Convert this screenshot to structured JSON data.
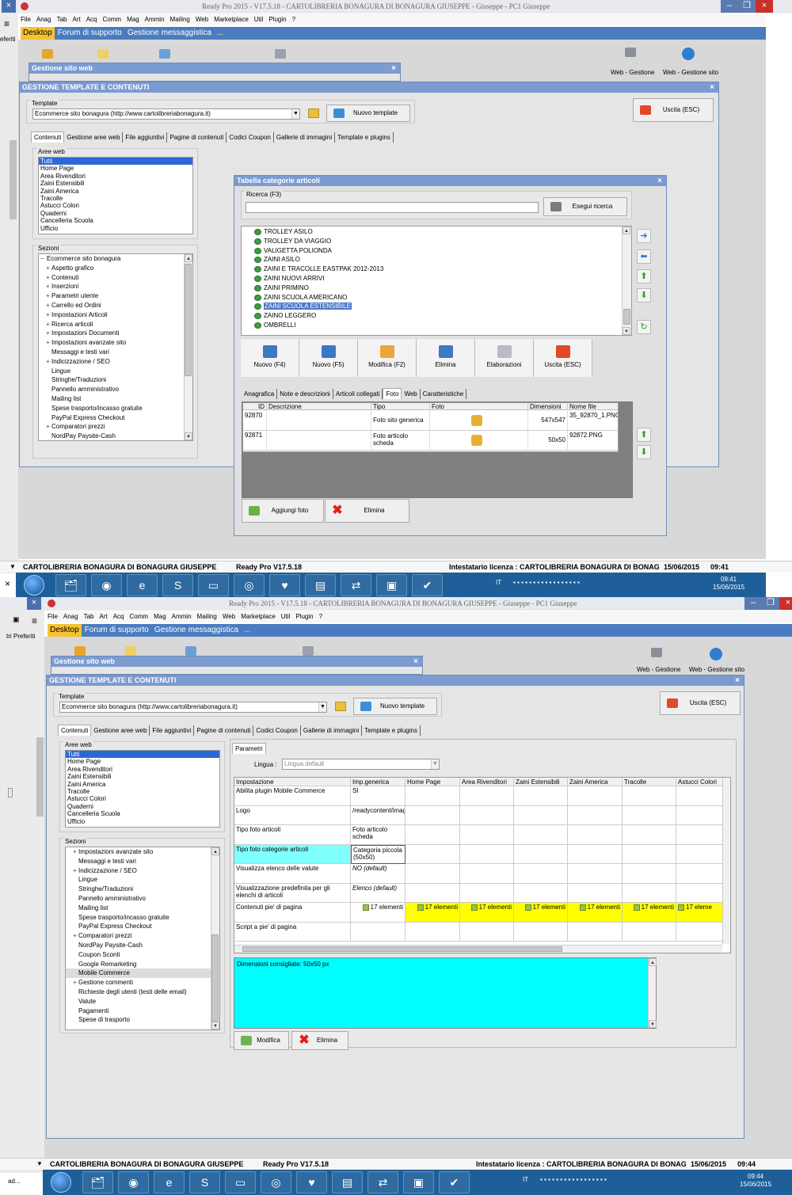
{
  "app": {
    "title": "Ready Pro 2015 - V17.5.18 - CARTOLIBRERIA BONAGURA DI BONAGURA GIUSEPPE - Giuseppe - PC1 Giuseppe"
  },
  "menu": [
    "File",
    "Anag",
    "Tab",
    "Art",
    "Acq",
    "Comm",
    "Mag",
    "Ammin",
    "Mailing",
    "Web",
    "Marketplace",
    "Util",
    "Plugin",
    "?"
  ],
  "main_tabs": [
    "Desktop",
    "Forum di supporto",
    "Gestione messaggistica",
    "..."
  ],
  "left_strip_label": "eferiti",
  "left_strip_label2": "tri Preferiti",
  "desktop_icons": {
    "web_gestione_ordini": "Web - Gestione ordini",
    "web_gestione_ordini_short": "Web - Gestione",
    "web_gestione_sito": "Web - Gestione sito"
  },
  "gestione_sito_web": {
    "title": "Gestione sito web",
    "close": "×"
  },
  "template_window": {
    "title": "GESTIONE TEMPLATE E CONTENUTI",
    "close": "×",
    "template_label": "Template",
    "template_value": "Ecommerce sito bonagura (http://www.cartolibreriabonagura.it)",
    "new_template": "Nuovo template",
    "exit": "Uscita (ESC)",
    "tabs": [
      "Contenuti",
      "Gestione aree web",
      "File aggiuntivi",
      "Pagine di contenuti",
      "Codici Coupon",
      "Gallerie di immagini",
      "Template e plugins"
    ],
    "aree_label": "Aree web",
    "aree": [
      "Tutti",
      "Home Page",
      "Area Rivenditori",
      "Zaini Estensibili",
      "Zaini America",
      "Tracolle",
      "Astucci Colori",
      "Quaderni",
      "Cancelleria Scuola",
      "Ufficio"
    ],
    "sezioni_label": "Sezioni",
    "sezioni1": [
      {
        "t": "Ecommerce sito bonagura",
        "k": "root"
      },
      {
        "t": "Aspetto grafico",
        "k": "plus"
      },
      {
        "t": "Contenuti",
        "k": "plus"
      },
      {
        "t": "Inserzioni",
        "k": "plus"
      },
      {
        "t": "Parametri utente",
        "k": "plus"
      },
      {
        "t": "Carrello ed Ordini",
        "k": "plus"
      },
      {
        "t": "Impostazioni Articoli",
        "k": "plus"
      },
      {
        "t": "Ricerca articoli",
        "k": "plus"
      },
      {
        "t": "Impostazioni Documenti",
        "k": "plus"
      },
      {
        "t": "Impostazioni avanzate sito",
        "k": "plus"
      },
      {
        "t": "Messaggi e testi vari",
        "k": ""
      },
      {
        "t": "Indicizzazione / SEO",
        "k": "plus"
      },
      {
        "t": "Lingue",
        "k": ""
      },
      {
        "t": "Stringhe/Traduzioni",
        "k": ""
      },
      {
        "t": "Pannello amministrativo",
        "k": ""
      },
      {
        "t": "Mailing list",
        "k": ""
      },
      {
        "t": "Spese trasporto/incasso gratuite",
        "k": ""
      },
      {
        "t": "PayPal Express Checkout",
        "k": ""
      },
      {
        "t": "Comparatori prezzi",
        "k": "plus"
      },
      {
        "t": "NordPay Paysite-Cash",
        "k": ""
      }
    ],
    "sezioni2": [
      {
        "t": "Impostazioni avanzate sito",
        "k": "plus"
      },
      {
        "t": "Messaggi e testi vari",
        "k": ""
      },
      {
        "t": "Indicizzazione / SEO",
        "k": "plus"
      },
      {
        "t": "Lingue",
        "k": ""
      },
      {
        "t": "Stringhe/Traduzioni",
        "k": ""
      },
      {
        "t": "Pannello amministrativo",
        "k": ""
      },
      {
        "t": "Mailing list",
        "k": ""
      },
      {
        "t": "Spese trasporto/incasso gratuite",
        "k": ""
      },
      {
        "t": "PayPal Express Checkout",
        "k": ""
      },
      {
        "t": "Comparatori prezzi",
        "k": "plus"
      },
      {
        "t": "NordPay Paysite-Cash",
        "k": ""
      },
      {
        "t": "Coupon Sconti",
        "k": ""
      },
      {
        "t": "Google Remarketing",
        "k": ""
      },
      {
        "t": "Mobile Commerce",
        "k": "hl"
      },
      {
        "t": "Gestione commenti",
        "k": "plus"
      },
      {
        "t": "Richieste degli utenti (testi delle email)",
        "k": ""
      },
      {
        "t": "Valute",
        "k": ""
      },
      {
        "t": "Pagamenti",
        "k": ""
      },
      {
        "t": "Spese di trasporto",
        "k": ""
      }
    ]
  },
  "categorie_window": {
    "title": "Tabella categorie articoli",
    "close": "×",
    "ricerca_label": "Ricerca (F3)",
    "ricerca_value": "",
    "esegui": "Esegui ricerca",
    "items": [
      "TROLLEY ASILO",
      "TROLLEY DA VIAGGIO",
      "VALIGETTA POLIONDA",
      "ZAINI ASILO",
      "ZAINI E TRACOLLE EASTPAK 2012-2013",
      "ZAINI NUOVI ARRIVI",
      "ZAINI PRIMINO",
      "ZAINI SCUOLA AMERICANO",
      "ZAINI SCUOLA ESTENSIBILE",
      "ZAINO LEGGERO",
      "OMBRELLI"
    ],
    "selected_index": 8,
    "tools": [
      "Nuovo (F4)",
      "Nuovo (F5)",
      "Modifica (F2)",
      "Elimina",
      "Elaborazioni",
      "Uscita (ESC)"
    ],
    "tabs": [
      "Anagrafica",
      "Note e descrizioni",
      "Articoli collegati",
      "Foto",
      "Web",
      "Caratteristiche"
    ],
    "foto_headers": [
      "ID",
      "Descrizione",
      "Tipo",
      "Foto",
      "Dimensioni",
      "Nome file"
    ],
    "foto_rows": [
      {
        "id": "92870",
        "descr": "",
        "tipo": "Foto sito generica",
        "dim": "547x547",
        "file": "35_92870_1.PNG"
      },
      {
        "id": "92871",
        "descr": "",
        "tipo": "Foto articolo scheda",
        "dim": "50x50",
        "file": "92872.PNG"
      }
    ],
    "aggiungi": "Aggiungi foto",
    "elimina": "Elimina"
  },
  "parametri": {
    "tab": "Parametri",
    "lingua_label": "Lingua :",
    "lingua_value": "Lingua default",
    "columns": [
      "Impostazione",
      "Imp.generica",
      "Home Page",
      "Area Rivenditori",
      "Zaini Estensibili",
      "Zaini America",
      "Tracolle",
      "Astucci Colori"
    ],
    "rows": [
      {
        "label": "Abilita plugin Mobile Commerce",
        "value": "SI"
      },
      {
        "label": "Logo",
        "value": "/readycontent/images/Cartolibre..."
      },
      {
        "label": "Tipo foto articoli",
        "value": "Foto articolo scheda"
      },
      {
        "label": "Tipo foto categorie articoli",
        "value": "Categoria piccola (50x50)"
      },
      {
        "label": "Visualizza elenco delle valute",
        "value": "NO (default)"
      },
      {
        "label": "Visualizzazione predefinita per gli elenchi di articoli",
        "value": "Elenco (default)"
      },
      {
        "label": "Contenuti pie' di pagina",
        "value": "17 elementi"
      },
      {
        "label": "Script a pie' di pagina",
        "value": ""
      }
    ],
    "row_elementi": "17 elementi",
    "row_elementi_cut": "17 eleme",
    "info": "Dimensioni consigliate: 50x50 px",
    "modifica": "Modifica",
    "elimina": "Elimina"
  },
  "status": {
    "company": "CARTOLIBRERIA BONAGURA DI BONAGURA GIUSEPPE",
    "version": "Ready Pro V17.5.18",
    "licenza": "Intestatario licenza : CARTOLIBRERIA BONAGURA DI BONAGU",
    "date": "15/06/2015",
    "time1": "09:41",
    "time2": "09:44"
  },
  "taskbar": {
    "lang": "IT",
    "clock_time1": "09:41",
    "clock_time2": "09:44",
    "clock_date": "15/06/2015",
    "left_label2": "ad..."
  },
  "colors": {
    "accent": "#4a7cbf",
    "title": "#7b9bd1",
    "selection": "#2c68d4",
    "highlight_yellow": "#ffff00",
    "highlight_cyan": "#00ffff",
    "taskbar": "#1e5f99"
  },
  "icons": {
    "close": "close-icon",
    "folder": "folder-icon",
    "binoculars": "binoculars-icon",
    "arrow_up": "arrow-up-icon",
    "arrow_down": "arrow-down-icon",
    "arrow_right": "arrow-right-icon",
    "arrow_left": "arrow-left-icon"
  }
}
